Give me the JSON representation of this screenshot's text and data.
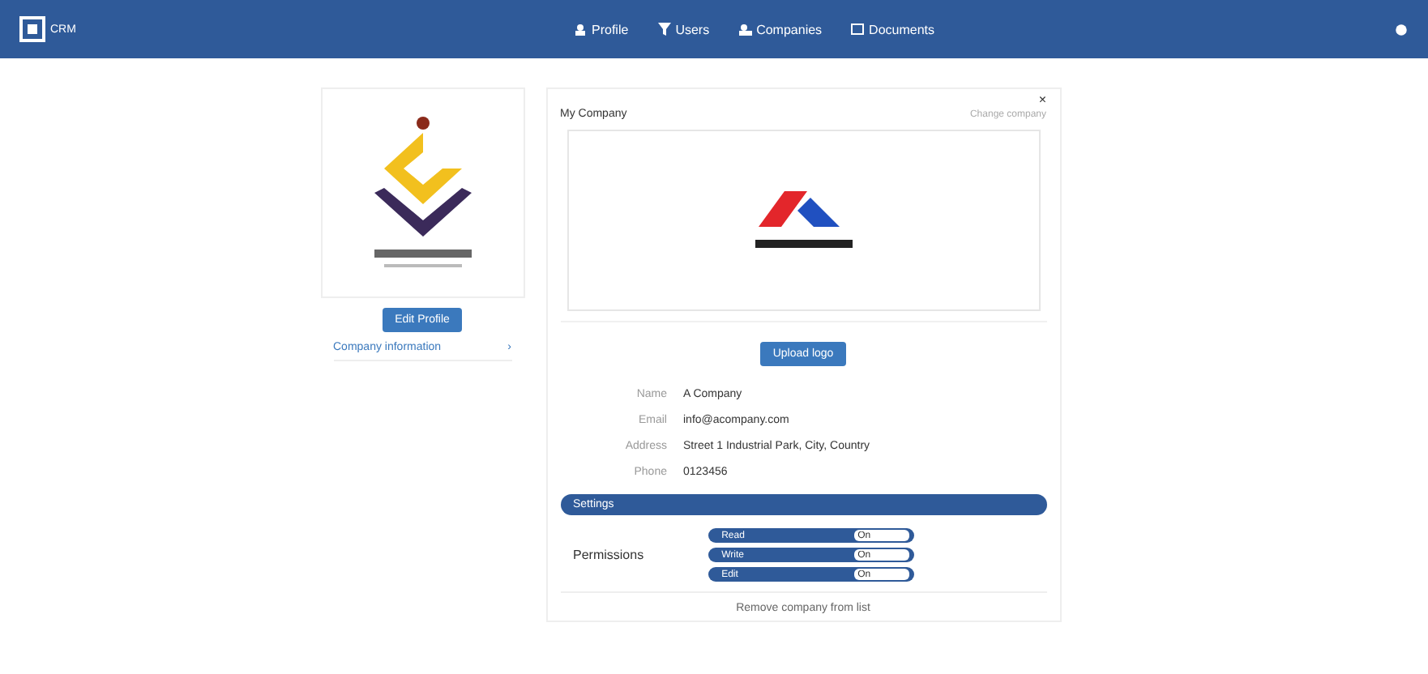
{
  "navbar": {
    "brand": "CRM",
    "items": [
      {
        "label": "Profile"
      },
      {
        "label": "Users"
      },
      {
        "label": "Companies"
      },
      {
        "label": "Documents"
      }
    ]
  },
  "profile_card": {
    "button": "Edit Profile",
    "link": "Company information",
    "link_arrow": "›"
  },
  "company_card": {
    "title": "My Company",
    "action": "Change company",
    "close": "×",
    "upload_button": "Upload logo",
    "fields": [
      {
        "label": "Name",
        "value": "A Company"
      },
      {
        "label": "Email",
        "value": "info@acompany.com"
      },
      {
        "label": "Address",
        "value": "Street 1 Industrial Park, City, Country"
      },
      {
        "label": "Phone",
        "value": "0123456"
      }
    ],
    "section": "Settings",
    "permissions": {
      "label": "Permissions",
      "items": [
        {
          "label": "Read",
          "value": "On"
        },
        {
          "label": "Write",
          "value": "On"
        },
        {
          "label": "Edit",
          "value": "On"
        }
      ]
    },
    "footer_link": "Remove company from list"
  }
}
